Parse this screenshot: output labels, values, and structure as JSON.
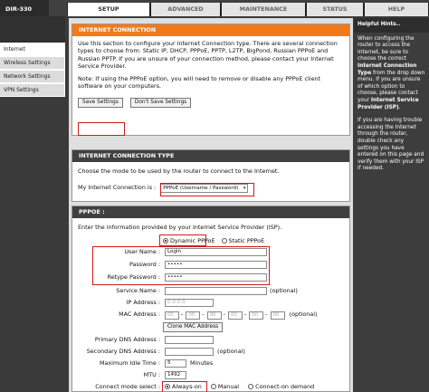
{
  "model": "DIR-330",
  "tabs": [
    "SETUP",
    "ADVANCED",
    "MAINTENANCE",
    "STATUS",
    "HELP"
  ],
  "sidebar": [
    "Internet",
    "Wireless Settings",
    "Network Settings",
    "VPN Settings"
  ],
  "internet_connection": {
    "title": "INTERNET CONNECTION",
    "intro": "Use this section to configure your Internet Connection type. There are several connection types to choose from: Static IP, DHCP, PPPoE, PPTP, L2TP, BigPond, Russian PPPoE and Russian PPTP. If you are unsure of your connection method, please contact your Internet Service Provider.",
    "note": "Note: If using the PPPoE option, you will need to remove or disable any PPPoE client software on your computers.",
    "save_label": "Save Settings",
    "dont_save_label": "Don't Save Settings"
  },
  "connection_type": {
    "title": "INTERNET CONNECTION TYPE",
    "desc": "Choose the mode to be used by the router to connect to the Internet.",
    "label": "My Internet Connection is :",
    "value": "PPPoE (Username / Password)"
  },
  "pppoe": {
    "title": "PPPOE :",
    "desc": "Enter the information provided by your Internet Service Provider (ISP).",
    "dynamic_label": "Dynamic PPPoE",
    "static_label": "Static PPPoE",
    "username_label": "User Name :",
    "username_value": "Login",
    "password_label": "Password :",
    "password_value": "•••••",
    "retype_label": "Retype Password :",
    "retype_value": "•••••",
    "service_label": "Service Name :",
    "optional": "(optional)",
    "ip_label": "IP Address :",
    "ip_value": "0.0.0.0",
    "mac_label": "MAC Address :",
    "mac_octets": [
      "00",
      "00",
      "00",
      "00",
      "00",
      "00"
    ],
    "mac_sep": "-",
    "clone_label": "Clone MAC Address",
    "pdns_label": "Primary DNS Address :",
    "sdns_label": "Secondary DNS Address :",
    "idle_label": "Maximum Idle Time :",
    "idle_value": "5",
    "idle_unit": "Minutes",
    "mtu_label": "MTU :",
    "mtu_value": "1492",
    "mode_label": "Connect mode select :",
    "mode_always": "Always-on",
    "mode_manual": "Manual",
    "mode_demand": "Connect-on demand"
  },
  "help": {
    "title": "Helpful Hints..",
    "p1_pre": "When configuring the router to access the Internet, be sure to choose the correct ",
    "p1_bold": "Internet Connection Type",
    "p1_post": " from the drop down menu. If you are unsure of which option to choose, please contact your ",
    "p1_bold2": "Internet Service Provider (ISP)",
    "p1_end": ".",
    "p2": "If you are having trouble accessing the Internet through the router, double check any settings you have entered on this page and verify them with your ISP if needed."
  },
  "colors": {
    "accent": "#f07a1c",
    "highlight": "#d21a1a",
    "dark": "#404040"
  }
}
